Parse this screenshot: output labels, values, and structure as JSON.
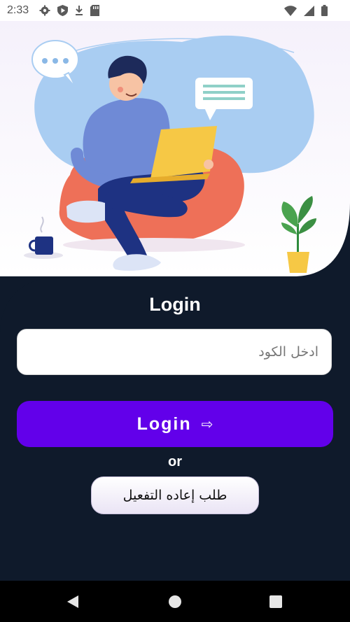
{
  "status_bar": {
    "time": "2:33"
  },
  "login": {
    "title": "Login",
    "code_placeholder": "ادخل الكود",
    "button_label": "Login",
    "button_arrow": "⇨"
  },
  "or_text": "or",
  "reactivation_button_label": "طلب إعاده التفعيل",
  "colors": {
    "background_dark": "#0f1a2b",
    "primary_button": "#6200ea",
    "navigation_bar": "#000000"
  }
}
